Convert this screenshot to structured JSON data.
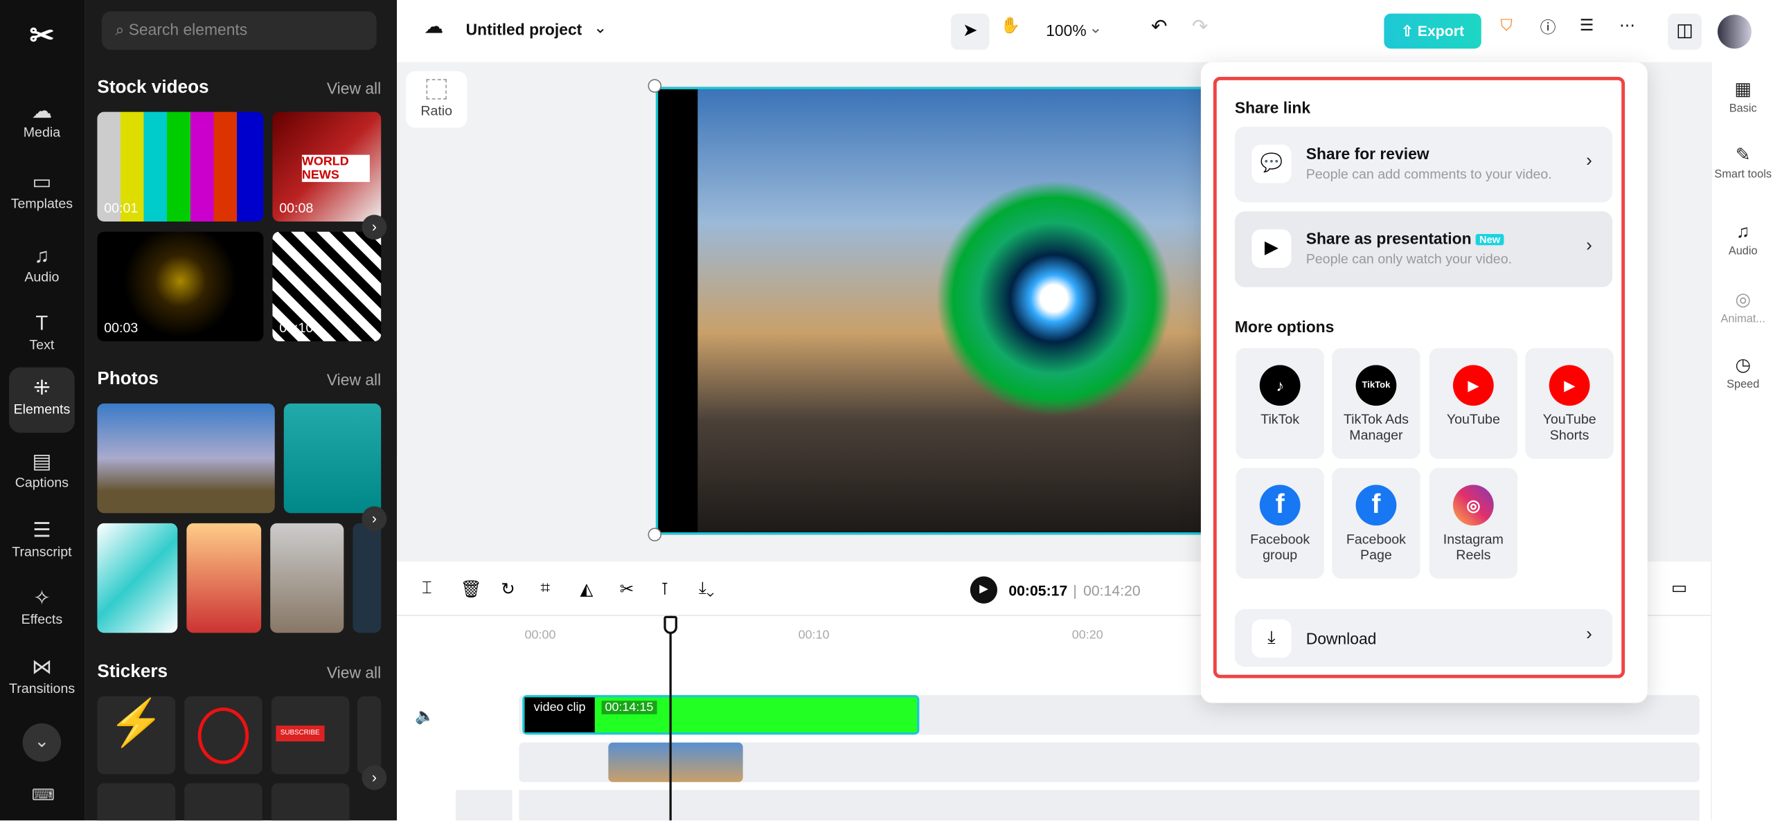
{
  "rail": {
    "items": [
      {
        "label": "Media",
        "icon": "cloud-icon"
      },
      {
        "label": "Templates",
        "icon": "template-icon"
      },
      {
        "label": "Audio",
        "icon": "music-icon"
      },
      {
        "label": "Text",
        "icon": "text-icon"
      },
      {
        "label": "Elements",
        "icon": "elements-icon"
      },
      {
        "label": "Captions",
        "icon": "captions-icon"
      },
      {
        "label": "Transcript",
        "icon": "transcript-icon"
      },
      {
        "label": "Effects",
        "icon": "effects-icon"
      },
      {
        "label": "Transitions",
        "icon": "transitions-icon"
      }
    ]
  },
  "panel": {
    "search_placeholder": "Search elements",
    "stock_title": "Stock videos",
    "photos_title": "Photos",
    "stickers_title": "Stickers",
    "view_all": "View all",
    "videos": [
      {
        "dur": "00:01"
      },
      {
        "dur": "00:08",
        "text": "WORLD NEWS"
      },
      {
        "dur": "00:03"
      },
      {
        "dur": "00:10"
      }
    ],
    "sticker_text": "SUBSCRIBE"
  },
  "topbar": {
    "project": "Untitled project",
    "zoom": "100%",
    "export": "Export"
  },
  "canvas": {
    "ratio": "Ratio"
  },
  "right": {
    "items": [
      "Basic",
      "Smart tools",
      "Audio",
      "Animat...",
      "Speed"
    ]
  },
  "player": {
    "current": "00:05:17",
    "total": "00:14:20"
  },
  "timeline": {
    "ticks": [
      "00:00",
      "00:10",
      "00:20"
    ],
    "clip_label": "video clip",
    "clip_dur": "00:14:15"
  },
  "popup": {
    "share_link": "Share link",
    "review_title": "Share for review",
    "review_sub": "People can add comments to your video.",
    "pres_title": "Share as presentation",
    "pres_badge": "New",
    "pres_sub": "People can only watch your video.",
    "more": "More options",
    "tiles": [
      {
        "label": "TikTok",
        "color": "#000000"
      },
      {
        "label": "TikTok Ads Manager",
        "color": "#000000",
        "logo": "TikTok"
      },
      {
        "label": "YouTube",
        "color": "#ff0000"
      },
      {
        "label": "YouTube Shorts",
        "color": "#ff0000"
      },
      {
        "label": "Facebook group",
        "color": "#1877f2"
      },
      {
        "label": "Facebook Page",
        "color": "#1877f2"
      },
      {
        "label": "Instagram Reels",
        "color": "#e1306c"
      }
    ],
    "download": "Download"
  }
}
